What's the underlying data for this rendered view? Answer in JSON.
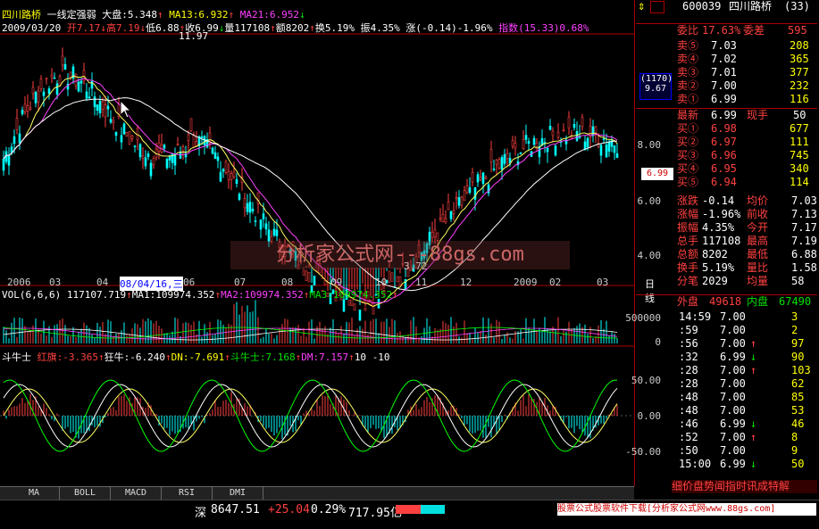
{
  "header": {
    "stock_name": "四川路桥",
    "indicator_name": "一线定强弱",
    "dapan": "大盘:5.348",
    "ma13": "MA13:6.932",
    "ma21": "MA21:6.952",
    "date": "2009/03/20",
    "open": "开7.17",
    "high": "高7.19",
    "low": "低6.88",
    "close": "收6.99",
    "volume": "量117108",
    "amount": "额8202",
    "turnover": "换5.19%",
    "amplitude": "振4.35%",
    "change": "涨(-0.14)-1.96%",
    "index": "指数(15.33)0.68%"
  },
  "main_chart": {
    "high_marker": "11.97",
    "low_marker": "3.72",
    "info_box": [
      "(1170)",
      "9.67"
    ],
    "y_labels": [
      "8.00",
      "6.00",
      "4.00"
    ],
    "price_tag": "6.99",
    "watermark": "分析家公式网---88gs.com",
    "x_labels": [
      "2006",
      "03",
      "04",
      "08/04/16,三",
      "06",
      "07",
      "08",
      "09",
      "10",
      "11",
      "12",
      "2009",
      "02",
      "03"
    ],
    "period": "日线"
  },
  "vol_panel": {
    "label": "VOL(6,6,6)",
    "value": "117107.719",
    "ma1": "MA1:109974.352",
    "ma2": "MA2:109974.352",
    "ma3": "MA3:109974.352",
    "y_labels": [
      "500000",
      "0"
    ]
  },
  "indicator_panel": {
    "name": "斗牛士",
    "hongjin": "红旗:-3.365",
    "kuangniu": "狂牛:-6.240",
    "dn": "DN:-7.691",
    "doushi": "斗牛士:7.168",
    "dm": "DM:7.157",
    "p1": "10",
    "p2": "-10",
    "y_labels": [
      "50.00",
      "0.00",
      "-50.00"
    ]
  },
  "tabs": [
    "MA",
    "BOLL",
    "MACD",
    "RSI",
    "DMI"
  ],
  "right_panel": {
    "code": "600039",
    "name": "四川路桥",
    "num": "(33)",
    "weibi_label": "委比",
    "weibi": "17.63%",
    "weicha_label": "委差",
    "weicha": "595",
    "sells": [
      {
        "label": "卖⑤",
        "price": "7.03",
        "vol": "208"
      },
      {
        "label": "卖④",
        "price": "7.02",
        "vol": "365"
      },
      {
        "label": "卖③",
        "price": "7.01",
        "vol": "377"
      },
      {
        "label": "卖②",
        "price": "7.00",
        "vol": "232"
      },
      {
        "label": "卖①",
        "price": "6.99",
        "vol": "116"
      }
    ],
    "latest_label": "最新",
    "latest": "6.99",
    "xianshou_label": "现手",
    "xianshou": "50",
    "buys": [
      {
        "label": "买①",
        "price": "6.98",
        "vol": "677"
      },
      {
        "label": "买②",
        "price": "6.97",
        "vol": "111"
      },
      {
        "label": "买③",
        "price": "6.96",
        "vol": "745"
      },
      {
        "label": "买④",
        "price": "6.95",
        "vol": "340"
      },
      {
        "label": "买⑤",
        "price": "6.94",
        "vol": "114"
      }
    ],
    "stats": [
      {
        "l1": "涨跌",
        "v1": "-0.14",
        "l2": "均价",
        "v2": "7.03"
      },
      {
        "l1": "涨幅",
        "v1": "-1.96%",
        "l2": "前收",
        "v2": "7.13"
      },
      {
        "l1": "振幅",
        "v1": "4.35%",
        "l2": "今开",
        "v2": "7.17"
      },
      {
        "l1": "总手",
        "v1": "117108",
        "l2": "最高",
        "v2": "7.19"
      },
      {
        "l1": "总额",
        "v1": "8202",
        "l2": "最低",
        "v2": "6.88"
      },
      {
        "l1": "换手",
        "v1": "5.19%",
        "l2": "量比",
        "v2": "1.58"
      },
      {
        "l1": "分笔",
        "v1": "2029",
        "l2": "均量",
        "v2": "58"
      }
    ],
    "waipan_label": "外盘",
    "waipan": "49618",
    "neipan_label": "内盘",
    "neipan": "67490",
    "ticks": [
      {
        "t": "14:59",
        "p": "7.00",
        "a": "",
        "v": "3"
      },
      {
        "t": ":59",
        "p": "7.00",
        "a": "",
        "v": "2"
      },
      {
        "t": ":56",
        "p": "7.00",
        "a": "↑",
        "v": "97"
      },
      {
        "t": ":32",
        "p": "6.99",
        "a": "↓",
        "v": "90"
      },
      {
        "t": ":28",
        "p": "7.00",
        "a": "↑",
        "v": "103"
      },
      {
        "t": ":28",
        "p": "7.00",
        "a": "",
        "v": "62"
      },
      {
        "t": ":48",
        "p": "7.00",
        "a": "",
        "v": "85"
      },
      {
        "t": ":48",
        "p": "7.00",
        "a": "",
        "v": "53"
      },
      {
        "t": ":46",
        "p": "6.99",
        "a": "↓",
        "v": "46"
      },
      {
        "t": ":52",
        "p": "7.00",
        "a": "↑",
        "v": "8"
      },
      {
        "t": ":50",
        "p": "7.00",
        "a": "",
        "v": "9"
      },
      {
        "t": "15:00",
        "p": "6.99",
        "a": "↓",
        "v": "50"
      }
    ],
    "bottom_tabs": "细价盘势闻指时讯成特解"
  },
  "status": {
    "market": "深",
    "index": "8647.51",
    "change": "+25.04",
    "pct": "0.29%",
    "amount": "717.95亿",
    "ad": "股票公式股票软件下载[分析家公式网www.88gs.com]"
  }
}
